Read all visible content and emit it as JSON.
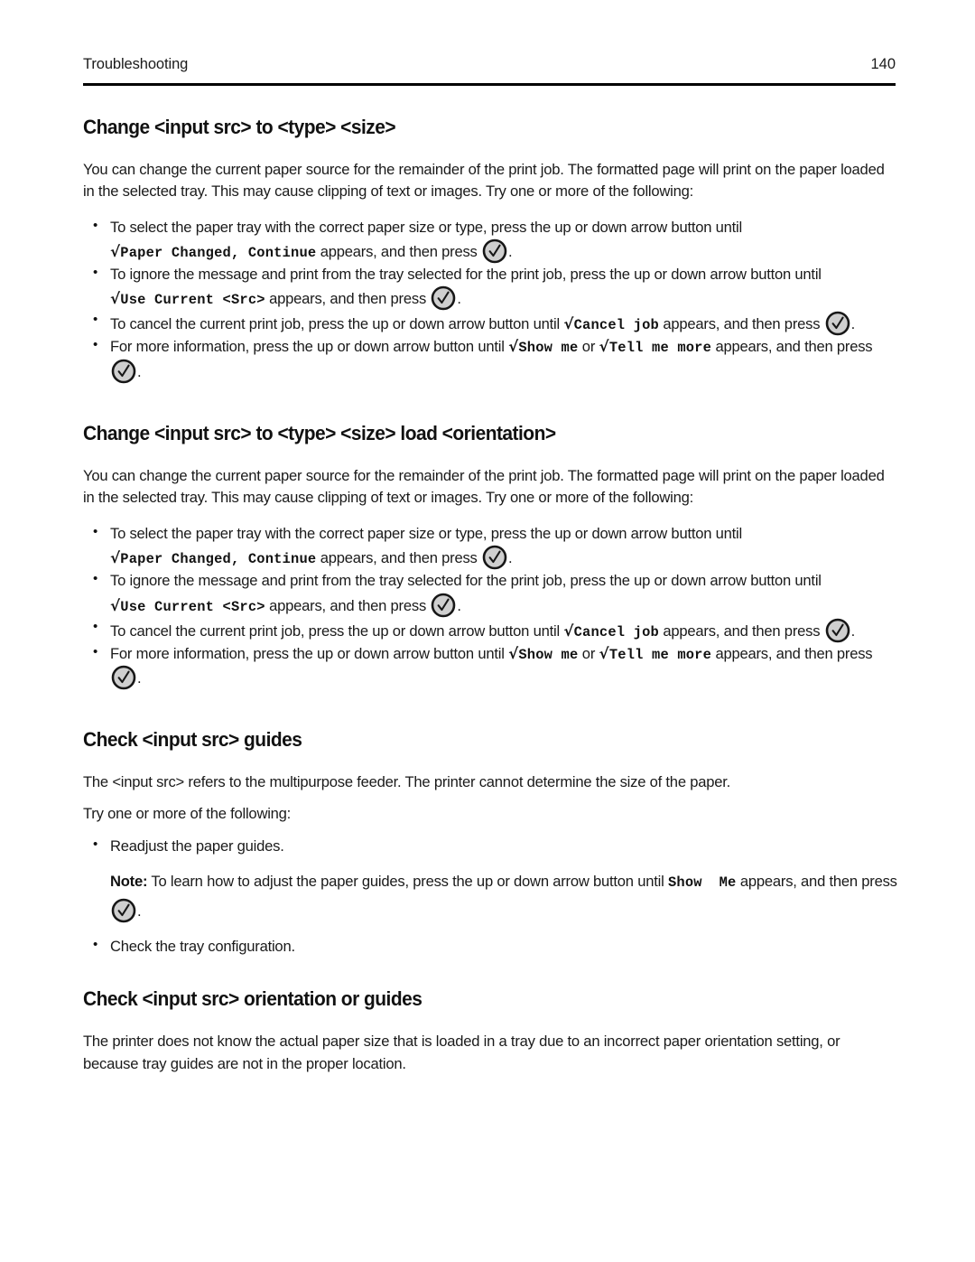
{
  "header": {
    "title": "Troubleshooting",
    "page_number": "140"
  },
  "icons": {
    "select_button": "checkmark-circle-button",
    "check_prefix": "√"
  },
  "sections": [
    {
      "heading": "Change <input src> to <type> <size>",
      "intro": "You can change the current paper source for the remainder of the print job. The formatted page will print on the paper loaded in the selected tray. This may cause clipping of text or images. Try one or more of the following:",
      "bullets": [
        {
          "part1": "To select the paper tray with the correct paper size or type, press the up or down arrow button until ",
          "code1": "Paper Changed, Continue",
          "part2": " appears, and then press ",
          "part3": "."
        },
        {
          "part1": "To ignore the message and print from the tray selected for the print job, press the up or down arrow button until ",
          "code1": "Use Current <Src>",
          "part2": " appears, and then press ",
          "part3": "."
        },
        {
          "part1": "To cancel the current print job, press the up or down arrow button until ",
          "code1": "Cancel job",
          "part2": " appears, and then press ",
          "part3": "."
        },
        {
          "part1": "For more information, press the up or down arrow button until ",
          "code1": "Show me",
          "part2": " or ",
          "code2": "Tell me more",
          "part3": " appears, and then press ",
          "part4": "."
        }
      ]
    },
    {
      "heading": "Change <input src> to <type> <size> load <orientation>",
      "intro": "You can change the current paper source for the remainder of the print job. The formatted page will print on the paper loaded in the selected tray. This may cause clipping of text or images. Try one or more of the following:",
      "bullets": [
        {
          "part1": "To select the paper tray with the correct paper size or type, press the up or down arrow button until ",
          "code1": "Paper Changed, Continue",
          "part2": " appears, and then press ",
          "part3": "."
        },
        {
          "part1": "To ignore the message and print from the tray selected for the print job, press the up or down arrow button until ",
          "code1": "Use Current <Src>",
          "part2": " appears, and then press ",
          "part3": "."
        },
        {
          "part1": "To cancel the current print job, press the up or down arrow button until ",
          "code1": "Cancel job",
          "part2": " appears, and then press ",
          "part3": "."
        },
        {
          "part1": "For more information, press the up or down arrow button until ",
          "code1": "Show me",
          "part2": " or ",
          "code2": "Tell me more",
          "part3": " appears, and then press ",
          "part4": "."
        }
      ]
    },
    {
      "heading": "Check <input src> guides",
      "intro": "The <input src> refers to the multipurpose feeder. The printer cannot determine the size of the paper.",
      "intro2": "Try one or more of the following:",
      "bullets": [
        {
          "part1": "Readjust the paper guides."
        },
        {
          "part1": "Check the tray configuration."
        }
      ],
      "note": {
        "label": "Note:",
        "part1": " To learn how to adjust the paper guides, press the up or down arrow button until ",
        "code1": "Show  Me",
        "part2": " appears, and then press ",
        "part3": "."
      }
    },
    {
      "heading": "Check <input src> orientation or guides",
      "intro": "The printer does not know the actual paper size that is loaded in a tray due to an incorrect paper orientation setting, or because tray guides are not in the proper location."
    }
  ]
}
